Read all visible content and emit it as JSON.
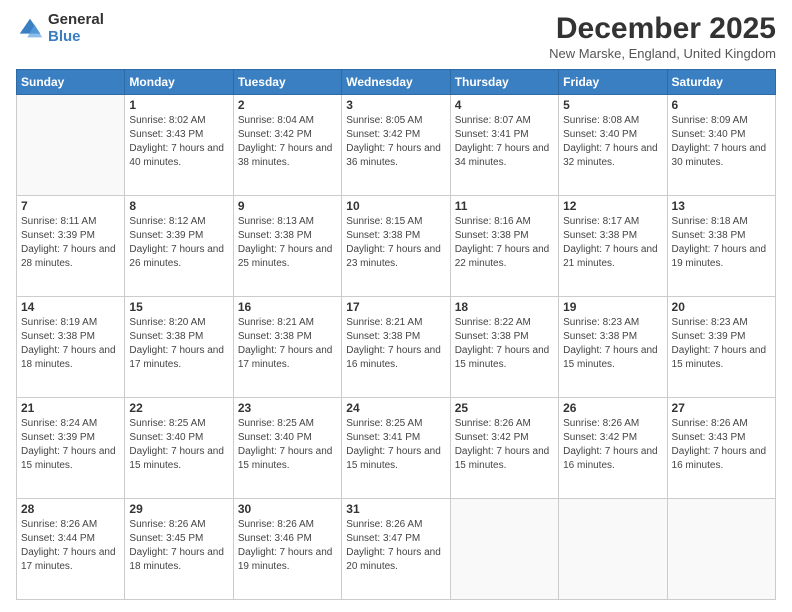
{
  "logo": {
    "general": "General",
    "blue": "Blue"
  },
  "title": "December 2025",
  "location": "New Marske, England, United Kingdom",
  "weekdays": [
    "Sunday",
    "Monday",
    "Tuesday",
    "Wednesday",
    "Thursday",
    "Friday",
    "Saturday"
  ],
  "weeks": [
    [
      {
        "day": "",
        "sunrise": "",
        "sunset": "",
        "daylight": ""
      },
      {
        "day": "1",
        "sunrise": "Sunrise: 8:02 AM",
        "sunset": "Sunset: 3:43 PM",
        "daylight": "Daylight: 7 hours and 40 minutes."
      },
      {
        "day": "2",
        "sunrise": "Sunrise: 8:04 AM",
        "sunset": "Sunset: 3:42 PM",
        "daylight": "Daylight: 7 hours and 38 minutes."
      },
      {
        "day": "3",
        "sunrise": "Sunrise: 8:05 AM",
        "sunset": "Sunset: 3:42 PM",
        "daylight": "Daylight: 7 hours and 36 minutes."
      },
      {
        "day": "4",
        "sunrise": "Sunrise: 8:07 AM",
        "sunset": "Sunset: 3:41 PM",
        "daylight": "Daylight: 7 hours and 34 minutes."
      },
      {
        "day": "5",
        "sunrise": "Sunrise: 8:08 AM",
        "sunset": "Sunset: 3:40 PM",
        "daylight": "Daylight: 7 hours and 32 minutes."
      },
      {
        "day": "6",
        "sunrise": "Sunrise: 8:09 AM",
        "sunset": "Sunset: 3:40 PM",
        "daylight": "Daylight: 7 hours and 30 minutes."
      }
    ],
    [
      {
        "day": "7",
        "sunrise": "Sunrise: 8:11 AM",
        "sunset": "Sunset: 3:39 PM",
        "daylight": "Daylight: 7 hours and 28 minutes."
      },
      {
        "day": "8",
        "sunrise": "Sunrise: 8:12 AM",
        "sunset": "Sunset: 3:39 PM",
        "daylight": "Daylight: 7 hours and 26 minutes."
      },
      {
        "day": "9",
        "sunrise": "Sunrise: 8:13 AM",
        "sunset": "Sunset: 3:38 PM",
        "daylight": "Daylight: 7 hours and 25 minutes."
      },
      {
        "day": "10",
        "sunrise": "Sunrise: 8:15 AM",
        "sunset": "Sunset: 3:38 PM",
        "daylight": "Daylight: 7 hours and 23 minutes."
      },
      {
        "day": "11",
        "sunrise": "Sunrise: 8:16 AM",
        "sunset": "Sunset: 3:38 PM",
        "daylight": "Daylight: 7 hours and 22 minutes."
      },
      {
        "day": "12",
        "sunrise": "Sunrise: 8:17 AM",
        "sunset": "Sunset: 3:38 PM",
        "daylight": "Daylight: 7 hours and 21 minutes."
      },
      {
        "day": "13",
        "sunrise": "Sunrise: 8:18 AM",
        "sunset": "Sunset: 3:38 PM",
        "daylight": "Daylight: 7 hours and 19 minutes."
      }
    ],
    [
      {
        "day": "14",
        "sunrise": "Sunrise: 8:19 AM",
        "sunset": "Sunset: 3:38 PM",
        "daylight": "Daylight: 7 hours and 18 minutes."
      },
      {
        "day": "15",
        "sunrise": "Sunrise: 8:20 AM",
        "sunset": "Sunset: 3:38 PM",
        "daylight": "Daylight: 7 hours and 17 minutes."
      },
      {
        "day": "16",
        "sunrise": "Sunrise: 8:21 AM",
        "sunset": "Sunset: 3:38 PM",
        "daylight": "Daylight: 7 hours and 17 minutes."
      },
      {
        "day": "17",
        "sunrise": "Sunrise: 8:21 AM",
        "sunset": "Sunset: 3:38 PM",
        "daylight": "Daylight: 7 hours and 16 minutes."
      },
      {
        "day": "18",
        "sunrise": "Sunrise: 8:22 AM",
        "sunset": "Sunset: 3:38 PM",
        "daylight": "Daylight: 7 hours and 15 minutes."
      },
      {
        "day": "19",
        "sunrise": "Sunrise: 8:23 AM",
        "sunset": "Sunset: 3:38 PM",
        "daylight": "Daylight: 7 hours and 15 minutes."
      },
      {
        "day": "20",
        "sunrise": "Sunrise: 8:23 AM",
        "sunset": "Sunset: 3:39 PM",
        "daylight": "Daylight: 7 hours and 15 minutes."
      }
    ],
    [
      {
        "day": "21",
        "sunrise": "Sunrise: 8:24 AM",
        "sunset": "Sunset: 3:39 PM",
        "daylight": "Daylight: 7 hours and 15 minutes."
      },
      {
        "day": "22",
        "sunrise": "Sunrise: 8:25 AM",
        "sunset": "Sunset: 3:40 PM",
        "daylight": "Daylight: 7 hours and 15 minutes."
      },
      {
        "day": "23",
        "sunrise": "Sunrise: 8:25 AM",
        "sunset": "Sunset: 3:40 PM",
        "daylight": "Daylight: 7 hours and 15 minutes."
      },
      {
        "day": "24",
        "sunrise": "Sunrise: 8:25 AM",
        "sunset": "Sunset: 3:41 PM",
        "daylight": "Daylight: 7 hours and 15 minutes."
      },
      {
        "day": "25",
        "sunrise": "Sunrise: 8:26 AM",
        "sunset": "Sunset: 3:42 PM",
        "daylight": "Daylight: 7 hours and 15 minutes."
      },
      {
        "day": "26",
        "sunrise": "Sunrise: 8:26 AM",
        "sunset": "Sunset: 3:42 PM",
        "daylight": "Daylight: 7 hours and 16 minutes."
      },
      {
        "day": "27",
        "sunrise": "Sunrise: 8:26 AM",
        "sunset": "Sunset: 3:43 PM",
        "daylight": "Daylight: 7 hours and 16 minutes."
      }
    ],
    [
      {
        "day": "28",
        "sunrise": "Sunrise: 8:26 AM",
        "sunset": "Sunset: 3:44 PM",
        "daylight": "Daylight: 7 hours and 17 minutes."
      },
      {
        "day": "29",
        "sunrise": "Sunrise: 8:26 AM",
        "sunset": "Sunset: 3:45 PM",
        "daylight": "Daylight: 7 hours and 18 minutes."
      },
      {
        "day": "30",
        "sunrise": "Sunrise: 8:26 AM",
        "sunset": "Sunset: 3:46 PM",
        "daylight": "Daylight: 7 hours and 19 minutes."
      },
      {
        "day": "31",
        "sunrise": "Sunrise: 8:26 AM",
        "sunset": "Sunset: 3:47 PM",
        "daylight": "Daylight: 7 hours and 20 minutes."
      },
      {
        "day": "",
        "sunrise": "",
        "sunset": "",
        "daylight": ""
      },
      {
        "day": "",
        "sunrise": "",
        "sunset": "",
        "daylight": ""
      },
      {
        "day": "",
        "sunrise": "",
        "sunset": "",
        "daylight": ""
      }
    ]
  ]
}
